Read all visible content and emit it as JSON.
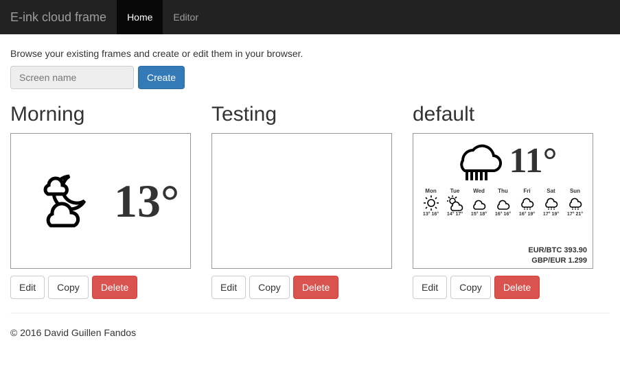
{
  "navbar": {
    "brand": "E-ink cloud frame",
    "items": [
      {
        "label": "Home",
        "active": true
      },
      {
        "label": "Editor",
        "active": false
      }
    ]
  },
  "description": "Browse your existing frames and create or edit them in your browser.",
  "create_form": {
    "placeholder": "Screen name",
    "button": "Create"
  },
  "buttons": {
    "edit": "Edit",
    "copy": "Copy",
    "delete": "Delete"
  },
  "frames": [
    {
      "title": "Morning",
      "weather": {
        "icon": "night-cloudy",
        "temp": "13°"
      }
    },
    {
      "title": "Testing",
      "empty": true
    },
    {
      "title": "default",
      "weather": {
        "icon": "rain",
        "temp": "11°"
      },
      "forecast": [
        {
          "day": "Mon",
          "icon": "sun",
          "lo": "13°",
          "hi": "16°"
        },
        {
          "day": "Tue",
          "icon": "partly",
          "lo": "14°",
          "hi": "17°"
        },
        {
          "day": "Wed",
          "icon": "cloud",
          "lo": "15°",
          "hi": "18°"
        },
        {
          "day": "Thu",
          "icon": "cloud",
          "lo": "16°",
          "hi": "16°"
        },
        {
          "day": "Fri",
          "icon": "rain-sm",
          "lo": "16°",
          "hi": "19°"
        },
        {
          "day": "Sat",
          "icon": "rain-sm",
          "lo": "17°",
          "hi": "19°"
        },
        {
          "day": "Sun",
          "icon": "rain-sm",
          "lo": "17°",
          "hi": "21°"
        }
      ],
      "rates": [
        "EUR/BTC 393.90",
        "GBP/EUR 1.299"
      ]
    }
  ],
  "footer": "© 2016 David Guillen Fandos"
}
